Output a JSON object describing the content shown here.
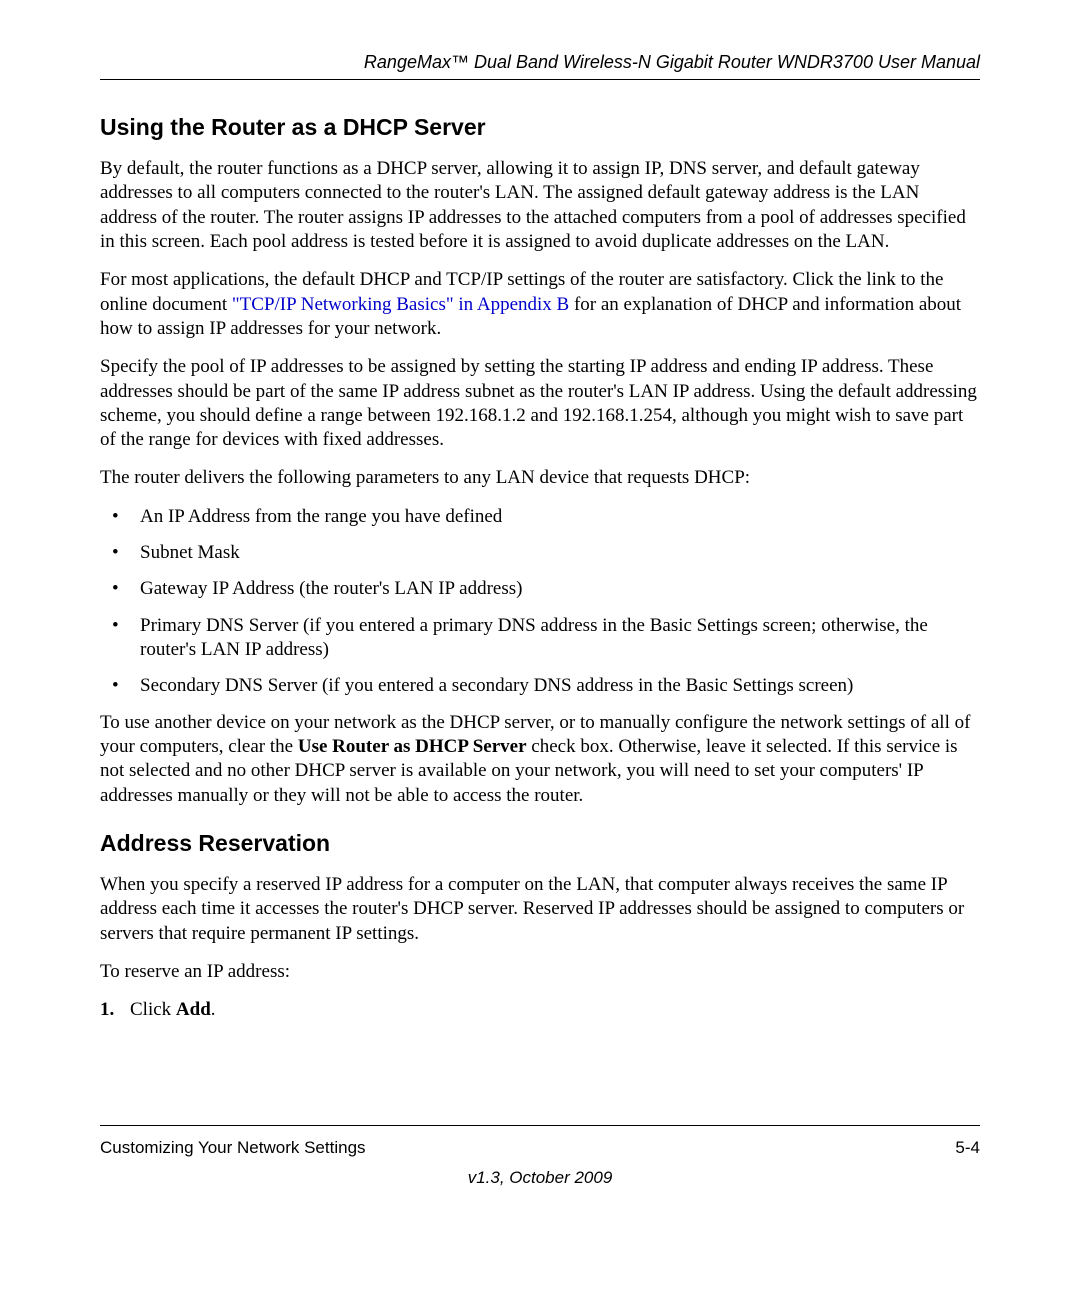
{
  "header": {
    "title": "RangeMax™ Dual Band Wireless-N Gigabit Router WNDR3700 User Manual"
  },
  "section1": {
    "heading": "Using the Router as a DHCP Server",
    "p1": "By default, the router functions as a DHCP server, allowing it to assign IP, DNS server, and default gateway addresses to all computers connected to the router's LAN. The assigned default gateway address is the LAN address of the router. The router assigns IP addresses to the attached computers from a pool of addresses specified in this screen. Each pool address is tested before it is assigned to avoid duplicate addresses on the LAN.",
    "p2_pre": "For most applications, the default DHCP and TCP/IP settings of the router are satisfactory. Click the link to the online document ",
    "p2_link": "\"TCP/IP Networking Basics\" in Appendix B",
    "p2_post": " for an explanation of DHCP and information about how to assign IP addresses for your network.",
    "p3": "Specify the pool of IP addresses to be assigned by setting the starting IP address and ending IP address. These addresses should be part of the same IP address subnet as the router's LAN IP address. Using the default addressing scheme, you should define a range between 192.168.1.2 and 192.168.1.254, although you might wish to save part of the range for devices with fixed addresses.",
    "p4": "The router delivers the following parameters to any LAN device that requests DHCP:",
    "bullets": [
      "An IP Address from the range you have defined",
      "Subnet Mask",
      "Gateway IP Address (the router's LAN IP address)",
      "Primary DNS Server (if you entered a primary DNS address in the Basic Settings screen; otherwise, the router's LAN IP address)",
      "Secondary DNS Server (if you entered a secondary DNS address in the Basic Settings screen)"
    ],
    "p5_pre": "To use another device on your network as the DHCP server, or to manually configure the network settings of all of your computers, clear the ",
    "p5_bold": "Use Router as DHCP Server",
    "p5_post": " check box. Otherwise, leave it selected. If this service is not selected and no other DHCP server is available on your network, you will need to set your computers' IP addresses manually or they will not be able to access the router."
  },
  "section2": {
    "heading": "Address Reservation",
    "p1": "When you specify a reserved IP address for a computer on the LAN, that computer always receives the same IP address each time it accesses the router's DHCP server. Reserved IP addresses should be assigned to computers or servers that require permanent IP settings.",
    "p2": "To reserve an IP address:",
    "step1_num": "1.",
    "step1_pre": "Click ",
    "step1_bold": "Add",
    "step1_post": "."
  },
  "footer": {
    "left": "Customizing Your Network Settings",
    "right": "5-4",
    "version": "v1.3, October 2009"
  }
}
